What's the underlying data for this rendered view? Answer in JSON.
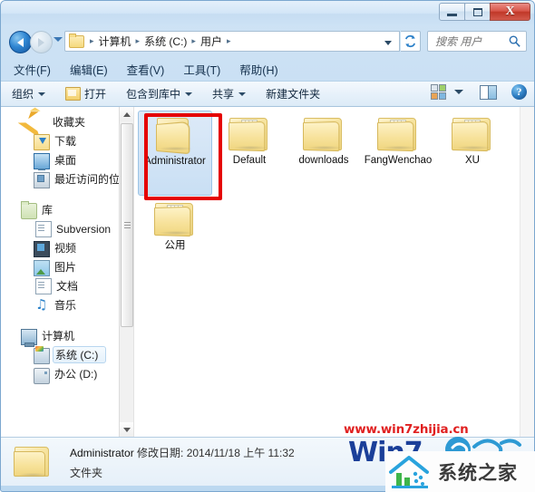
{
  "window": {
    "controls": {
      "minimize": "–",
      "maximize": "□",
      "close": "X"
    }
  },
  "address_bar": {
    "back_tooltip": "后退",
    "forward_tooltip": "前进",
    "breadcrumbs": [
      "计算机",
      "系统 (C:)",
      "用户"
    ],
    "separator": "▸",
    "refresh_label": "↻"
  },
  "search": {
    "placeholder": "搜索 用户",
    "value": ""
  },
  "menu": {
    "items": [
      {
        "label": "文件(F)"
      },
      {
        "label": "编辑(E)"
      },
      {
        "label": "查看(V)"
      },
      {
        "label": "工具(T)"
      },
      {
        "label": "帮助(H)"
      }
    ]
  },
  "toolbar": {
    "organize": "组织",
    "open": "打开",
    "include_in_library": "包含到库中",
    "share": "共享",
    "new_folder": "新建文件夹",
    "help_glyph": "?"
  },
  "sidebar": {
    "groups": [
      {
        "header": {
          "label": "收藏夹",
          "icon": "star-icon"
        },
        "items": [
          {
            "label": "下载",
            "icon": "download-folder-icon"
          },
          {
            "label": "桌面",
            "icon": "desktop-icon"
          },
          {
            "label": "最近访问的位置",
            "icon": "recent-places-icon"
          }
        ]
      },
      {
        "header": {
          "label": "库",
          "icon": "library-icon"
        },
        "items": [
          {
            "label": "Subversion",
            "icon": "document-icon"
          },
          {
            "label": "视频",
            "icon": "video-icon"
          },
          {
            "label": "图片",
            "icon": "picture-icon"
          },
          {
            "label": "文档",
            "icon": "document-icon"
          },
          {
            "label": "音乐",
            "icon": "music-note-icon"
          }
        ]
      },
      {
        "header": {
          "label": "计算机",
          "icon": "computer-icon"
        },
        "items": [
          {
            "label": "系统 (C:)",
            "icon": "system-drive-icon",
            "selected": true
          },
          {
            "label": "办公 (D:)",
            "icon": "drive-icon",
            "selected": false
          }
        ]
      }
    ]
  },
  "content": {
    "files": [
      {
        "name": "Administrator",
        "type": "folder",
        "selected": true,
        "highlighted": true
      },
      {
        "name": "Default",
        "type": "folder",
        "selected": false,
        "highlighted": false
      },
      {
        "name": "downloads",
        "type": "folder",
        "selected": false,
        "highlighted": false
      },
      {
        "name": "FangWenchao",
        "type": "folder",
        "selected": false,
        "highlighted": false
      },
      {
        "name": "XU",
        "type": "folder",
        "selected": false,
        "highlighted": false
      },
      {
        "name": "公用",
        "type": "folder",
        "selected": false,
        "highlighted": false
      }
    ]
  },
  "details": {
    "name": "Administrator",
    "modified": "修改日期: 2014/11/18 上午 11:32",
    "type": "文件夹"
  },
  "watermarks": {
    "url": "www.win7zhijia.cn",
    "brand_en": "Win7",
    "brand_cn": "系统之家",
    "faint": "www.win7zhijia.cn"
  },
  "colors": {
    "highlight_red": "#e50000",
    "selection_blue": "#c9dff4",
    "watermark_red": "#e02020",
    "brand_blue": "#1b3f99"
  }
}
